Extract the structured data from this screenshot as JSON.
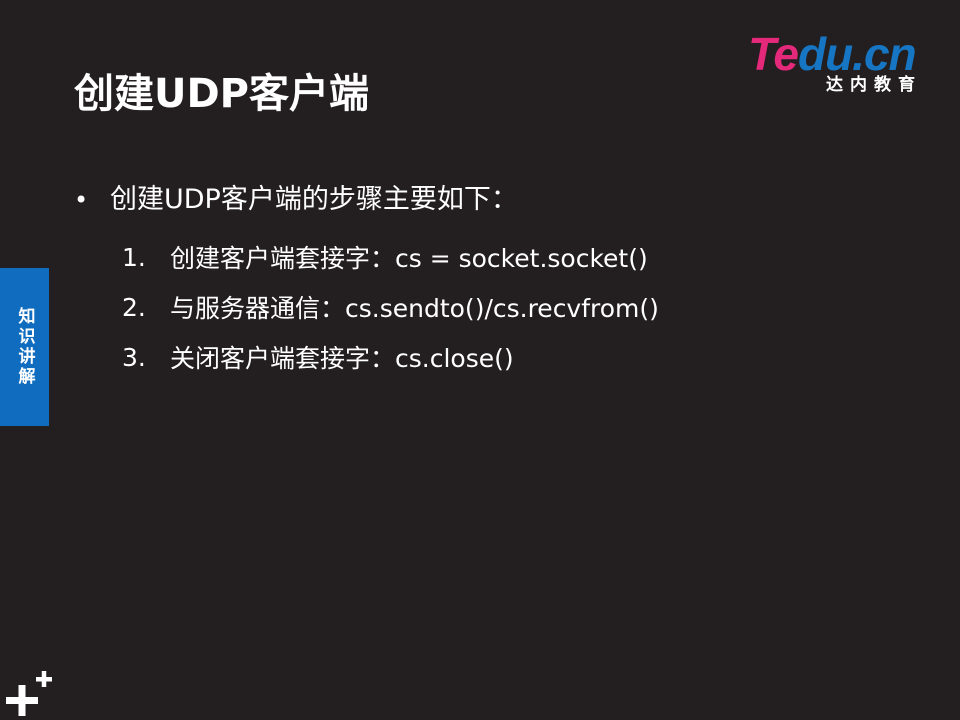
{
  "slide": {
    "title": "创建UDP客户端",
    "logo": {
      "brand_text": "Tedu.cn",
      "sub_text": "达内教育"
    },
    "side_tab": "知识讲解",
    "bullet": {
      "marker": "•",
      "text": "创建UDP客户端的步骤主要如下："
    },
    "steps": [
      {
        "num": "1.",
        "text": "创建客户端套接字：cs  = socket.socket()"
      },
      {
        "num": "2.",
        "text": "与服务器通信：cs.sendto()/cs.recvfrom()"
      },
      {
        "num": "3.",
        "text": "关闭客户端套接字：cs.close()"
      }
    ],
    "icons": {
      "corner": "plus-plus-icon"
    },
    "colors": {
      "background": "#231f20",
      "side_tab": "#0f6cbf",
      "logo_pink": "#e4287a",
      "logo_blue": "#1776c3",
      "text": "#ffffff"
    }
  }
}
